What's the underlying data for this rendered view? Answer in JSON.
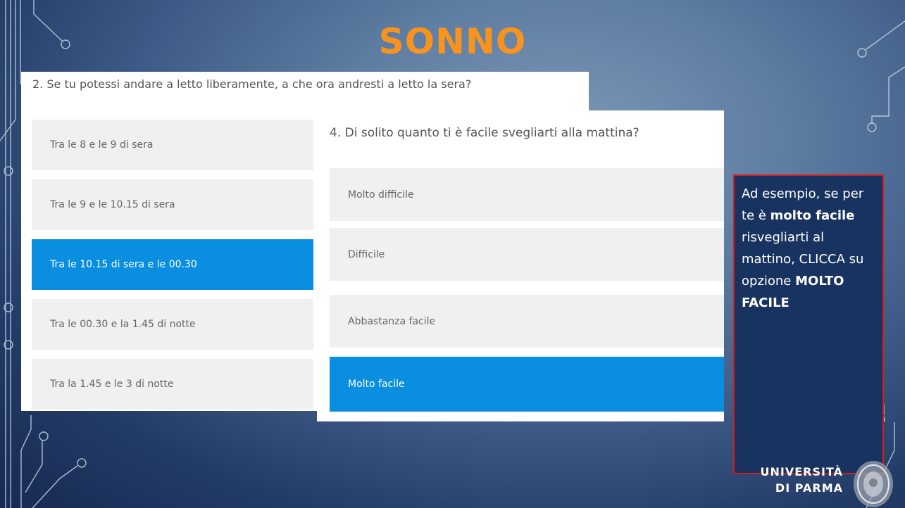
{
  "slide": {
    "title": "SONNO"
  },
  "question2": {
    "text": "2. Se tu potessi andare a letto liberamente, a che ora andresti a letto la sera?",
    "options": [
      {
        "label": "Tra le 8 e le 9 di sera",
        "selected": false
      },
      {
        "label": "Tra le 9 e le 10.15 di sera",
        "selected": false
      },
      {
        "label": "Tra le 10.15 di sera e le 00.30",
        "selected": true
      },
      {
        "label": "Tra le 00.30 e la 1.45 di notte",
        "selected": false
      },
      {
        "label": "Tra la 1.45 e le 3 di notte",
        "selected": false
      }
    ]
  },
  "question4": {
    "text": "4. Di solito quanto ti è facile svegliarti alla mattina?",
    "options": [
      {
        "label": "Molto difficile",
        "selected": false
      },
      {
        "label": "Difficile",
        "selected": false
      },
      {
        "label": "Abbastanza facile",
        "selected": false
      },
      {
        "label": "Molto facile",
        "selected": true
      }
    ]
  },
  "instruction": {
    "part1": "Ad esempio, se per te è ",
    "bold1": "molto facile",
    "part2": " risvegliarti al mattino, CLICCA su opzione ",
    "bold2": "MOLTO FACILE"
  },
  "logo": {
    "line1": "UNIVERSITÀ",
    "line2": "DI PARMA"
  },
  "colors": {
    "title": "#f7931e",
    "selected_option": "#0a8ee0",
    "note_border": "#d11f1f"
  }
}
